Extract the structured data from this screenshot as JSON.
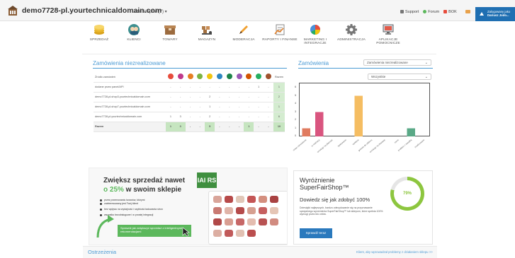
{
  "topbar": {
    "domain": "demo7728-pl.yourtechnicaldomain.com",
    "shops_label": "Lista sklepów (7) ▾",
    "links": [
      {
        "label": "Support",
        "color": "#555555"
      },
      {
        "label": "Forum",
        "color": "#5cb85c"
      },
      {
        "label": "BOK",
        "color": "#e74c3c"
      }
    ],
    "user_line1": "Zalogowany jako",
    "user_line2": "Dariusz Jodo..."
  },
  "nav": [
    {
      "label": "SPRZEDAŻ",
      "icon": "coins-icon"
    },
    {
      "label": "KLIENCI",
      "icon": "clients-icon"
    },
    {
      "label": "TOWARY",
      "icon": "box-icon"
    },
    {
      "label": "MAGAZYN",
      "icon": "warehouse-icon"
    },
    {
      "label": "MODERACJA",
      "icon": "pencil-icon"
    },
    {
      "label": "RAPORTY I FINANSE",
      "icon": "report-icon"
    },
    {
      "label": "MARKETING I INTEGRACJE",
      "icon": "pie-chart-icon"
    },
    {
      "label": "ADMINISTRACJA",
      "icon": "gear-icon"
    },
    {
      "label": "APLIKACJE POMOCNICZE",
      "icon": "monitor-icon"
    }
  ],
  "orders": {
    "title": "Zamówienia niezrealizowane",
    "source_header": "Źródło zamówień",
    "sum_header": "Razem",
    "status_colors": [
      "#e74c3c",
      "#c0398b",
      "#e67e22",
      "#7cb342",
      "#f1c40f",
      "#2e86c1",
      "#1e8449",
      "#9b59b6",
      "#d35400",
      "#27ae60",
      "#a0522d"
    ],
    "rows": [
      {
        "source": "dodane przez panel/API",
        "cells": [
          "-",
          "-",
          "-",
          "-",
          "-",
          "-",
          "-",
          "-",
          "-",
          "1",
          "-"
        ],
        "sum": "1"
      },
      {
        "source": "demo7728-pl-shop3.yourtechnicaldomain.com",
        "cells": [
          "-",
          "-",
          "-",
          "-",
          "2",
          "-",
          "-",
          "-",
          "-",
          "-",
          "-"
        ],
        "sum": "2"
      },
      {
        "source": "demo7728-pl-shop7.yourtechnicaldomain.com",
        "cells": [
          "-",
          "-",
          "-",
          "-",
          "1",
          "-",
          "-",
          "-",
          "-",
          "-",
          "-"
        ],
        "sum": "1"
      },
      {
        "source": "demo7728-pl.yourtechnicaldomain.com",
        "cells": [
          "1",
          "3",
          "-",
          "-",
          "2",
          "-",
          "-",
          "-",
          "-",
          "-",
          "-"
        ],
        "sum": "6"
      }
    ],
    "total": {
      "source": "Razem",
      "cells": [
        "1",
        "3",
        "-",
        "-",
        "5",
        "-",
        "-",
        "-",
        "1",
        "-",
        "-"
      ],
      "sum": "10"
    }
  },
  "orders_chart": {
    "title": "Zamówienia",
    "filter1": "Zamówienia niezrealizowane",
    "filter2": "Wszystkie"
  },
  "chart_data": {
    "type": "bar",
    "title": "",
    "xlabel": "",
    "ylabel": "",
    "ylim": [
      0,
      6
    ],
    "yticks": [
      0,
      1,
      2,
      3,
      4,
      5,
      6
    ],
    "categories": [
      "nowe zamówienie",
      "w realizacji",
      "oczekuje na płatność",
      "spakowane",
      "wysłane",
      "gotowe do odbioru",
      "oczekuje na dostawę",
      "zwrot",
      "problem z wysyłką",
      "zrealizowane"
    ],
    "values": [
      1,
      3,
      0,
      0,
      5,
      0,
      0,
      0,
      1,
      0
    ],
    "colors": [
      "#e07b5f",
      "#d9557f",
      "#e8a07a",
      "#f3c572",
      "#f5bd62",
      "#8fbf6e",
      "#6fa8d6",
      "#a68bc7",
      "#5aa987",
      "#b5a48f"
    ]
  },
  "banner": {
    "title": "Zwiększ sprzedaż nawet",
    "sub_pct": "o 25%",
    "sub_rest": " w swoim sklepie",
    "bullets": [
      "przez przemowaniu towarów, którymi",
      "zainteresowany jest Twój klient",
      "bez wpływu na wydajność i szybkość ładowania stron",
      "wszystko bezobsługowe i w prostej integracji"
    ],
    "button": "Sprawdź jak zwiększyć sprzedaż z inteligentnymi rekomendacjami",
    "logo_text": "IAI RS"
  },
  "superfair": {
    "title_line1": "Wyróżnienie",
    "title_line2": "SuperFairShop™",
    "heading": "Dowiedz się jak zdobyć 100%",
    "text": "Dziesiątki najlepszych, bardzo zdecydowanie się na przyznawanie specjalnego wyróżnienia SuperFairShop™ lub sklepom, które spełnia 100% wymogi przez kto celów.",
    "button": "Sprawdź teraz",
    "score": "79%",
    "score_value": 79
  },
  "warnings": {
    "title": "Ostrzeżenia",
    "link": "Klient, aby wprowadzał problemy z działaniem sklepu >>"
  }
}
